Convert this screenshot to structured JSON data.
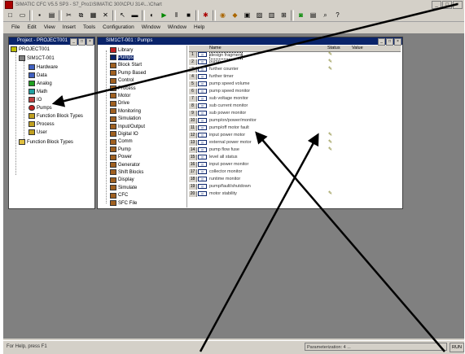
{
  "app": {
    "title": "SIMATIC CFC V5.5 SP3 - S7_Pro1\\SIMATIC 300\\CPU 314\\...\\Chart",
    "colors": {
      "titlebar": "#0a246a",
      "workspace": "#808080",
      "chrome": "#d4d0c8"
    }
  },
  "menubar": {
    "items": [
      "File",
      "Edit",
      "View",
      "Insert",
      "Tools",
      "Configuration",
      "Window",
      "Window",
      "Help"
    ]
  },
  "project_window": {
    "title": "Project - PROJECT001",
    "tree": [
      {
        "label": "PROJECT001",
        "icon": "project-icon"
      },
      {
        "label": "SIM1CT-001",
        "icon": "station-icon"
      },
      {
        "label": "Hardware",
        "icon": "hardware-icon"
      },
      {
        "label": "Data",
        "icon": "data-icon"
      },
      {
        "label": "Analog",
        "icon": "analog-icon"
      },
      {
        "label": "Math",
        "icon": "math-icon"
      },
      {
        "label": "IO",
        "icon": "io-icon"
      },
      {
        "label": "Pumps",
        "icon": "pumps-icon"
      },
      {
        "label": "Function Block Types",
        "icon": "fb-types-icon"
      },
      {
        "label": "Process",
        "icon": "process-icon"
      },
      {
        "label": "User",
        "icon": "user-icon"
      },
      {
        "label": "Function Block Types",
        "icon": "folder-icon"
      }
    ]
  },
  "library_window": {
    "title": "SIM1CT-001 : Pumps",
    "library_items": [
      {
        "label": "Library",
        "icon": "library-icon"
      },
      {
        "label": "Pumps",
        "icon": "pumps-icon",
        "selected": true
      },
      {
        "label": "Block Start",
        "icon": "block-icon"
      },
      {
        "label": "Pump Based",
        "icon": "block-icon"
      },
      {
        "label": "Control",
        "icon": "block-icon"
      },
      {
        "label": "Process",
        "icon": "block-icon"
      },
      {
        "label": "Motor",
        "icon": "block-icon"
      },
      {
        "label": "Drive",
        "icon": "block-icon"
      },
      {
        "label": "Monitoring",
        "icon": "block-icon"
      },
      {
        "label": "Simulation",
        "icon": "block-icon"
      },
      {
        "label": "Input/Output",
        "icon": "block-icon"
      },
      {
        "label": "Digital IO",
        "icon": "block-icon"
      },
      {
        "label": "Comm",
        "icon": "block-icon"
      },
      {
        "label": "Pump",
        "icon": "block-icon"
      },
      {
        "label": "Power",
        "icon": "block-icon"
      },
      {
        "label": "Generator",
        "icon": "block-icon"
      },
      {
        "label": "Shift Blocks",
        "icon": "block-icon"
      },
      {
        "label": "Display",
        "icon": "block-icon"
      },
      {
        "label": "Simulate",
        "icon": "block-icon"
      },
      {
        "label": "CFC",
        "icon": "block-icon"
      },
      {
        "label": "SFC File",
        "icon": "block-icon"
      }
    ],
    "columns": [
      "Name",
      "Status",
      "Value"
    ],
    "rows": [
      {
        "num": "1",
        "label": "design fragment",
        "pen": true
      },
      {
        "num": "2",
        "label": "pump",
        "pen": true
      },
      {
        "num": "3",
        "label": "further counter",
        "pen": true
      },
      {
        "num": "4",
        "label": "further timer",
        "pen": false
      },
      {
        "num": "5",
        "label": "pump speed volume",
        "pen": false
      },
      {
        "num": "6",
        "label": "pump speed monitor",
        "pen": false
      },
      {
        "num": "7",
        "label": "sub voltage monitor",
        "pen": false
      },
      {
        "num": "8",
        "label": "sub current monitor",
        "pen": false
      },
      {
        "num": "9",
        "label": "sub power monitor",
        "pen": false
      },
      {
        "num": "10",
        "label": "pump/on/power/monitor",
        "pen": false
      },
      {
        "num": "11",
        "label": "pump/off motor fault",
        "pen": false
      },
      {
        "num": "12",
        "label": "input power motor",
        "pen": true
      },
      {
        "num": "13",
        "label": "external power motor",
        "pen": true
      },
      {
        "num": "14",
        "label": "pump flow fuse",
        "pen": true
      },
      {
        "num": "15",
        "label": "level all status",
        "pen": false
      },
      {
        "num": "16",
        "label": "input power monitor",
        "pen": false
      },
      {
        "num": "17",
        "label": "collector monitor",
        "pen": false
      },
      {
        "num": "18",
        "label": "runtime monitor",
        "pen": false
      },
      {
        "num": "19",
        "label": "pump/fault/shutdown",
        "pen": false
      },
      {
        "num": "20",
        "label": "motor stability",
        "pen": true
      }
    ]
  },
  "statusbar": {
    "left": "For Help, press F1",
    "right": "Parameterization: 4 ...",
    "mode": "RUN"
  }
}
